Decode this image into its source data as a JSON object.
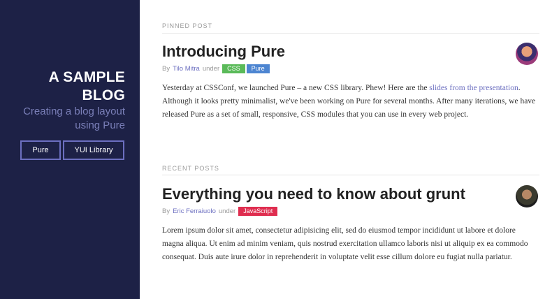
{
  "sidebar": {
    "title_line1": "A SAMPLE",
    "title_line2": "BLOG",
    "tagline_line1": "Creating a blog layout",
    "tagline_line2": "using Pure",
    "nav": [
      {
        "label": "Pure"
      },
      {
        "label": "YUI Library"
      }
    ]
  },
  "sections": {
    "pinned_label": "PINNED POST",
    "recent_label": "RECENT POSTS"
  },
  "posts": [
    {
      "title": "Introducing Pure",
      "by": "By",
      "author": "Tilo Mitra",
      "under": "under",
      "tags": [
        "CSS",
        "Pure"
      ],
      "body_before_link": "Yesterday at CSSConf, we launched Pure – a new CSS library. Phew! Here are the ",
      "link_text": "slides from the presentation",
      "body_after_link": ". Although it looks pretty minimalist, we've been working on Pure for several months. After many iterations, we have released Pure as a set of small, responsive, CSS modules that you can use in every web project."
    },
    {
      "title": "Everything you need to know about grunt",
      "by": "By",
      "author": "Eric Ferraiuolo",
      "under": "under",
      "tags": [
        "JavaScript"
      ],
      "body": "Lorem ipsum dolor sit amet, consectetur adipisicing elit, sed do eiusmod tempor incididunt ut labore et dolore magna aliqua. Ut enim ad minim veniam, quis nostrud exercitation ullamco laboris nisi ut aliquip ex ea commodo consequat. Duis aute irure dolor in reprehenderit in voluptate velit esse cillum dolore eu fugiat nulla pariatur."
    }
  ],
  "colors": {
    "sidebar_bg": "#1d2146",
    "accent": "#6c6fc0",
    "tag_css": "#5aba59",
    "tag_pure": "#4d85d1",
    "tag_js": "#df2d4f"
  }
}
